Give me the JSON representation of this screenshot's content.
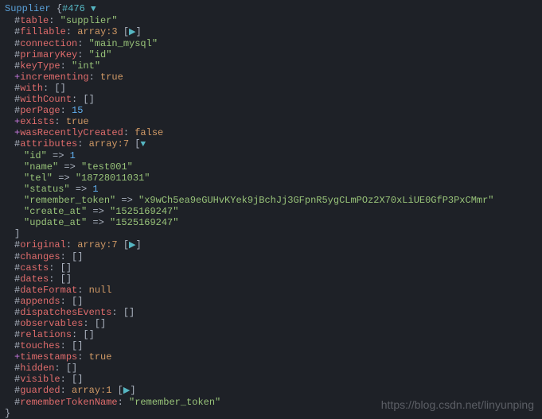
{
  "header": {
    "class_name": "Supplier",
    "hash_id": "#476",
    "arrow": "▼"
  },
  "props": [
    {
      "prefix": "#",
      "name": "table",
      "type": "str",
      "value": "\"supplier\""
    },
    {
      "prefix": "#",
      "name": "fillable",
      "type": "arr",
      "value": "array:3",
      "expand": "▶"
    },
    {
      "prefix": "#",
      "name": "connection",
      "type": "str",
      "value": "\"main_mysql\""
    },
    {
      "prefix": "#",
      "name": "primaryKey",
      "type": "str",
      "value": "\"id\""
    },
    {
      "prefix": "#",
      "name": "keyType",
      "type": "str",
      "value": "\"int\""
    },
    {
      "prefix": "+",
      "name": "incrementing",
      "type": "bool",
      "value": "true"
    },
    {
      "prefix": "#",
      "name": "with",
      "type": "empty",
      "value": "[]"
    },
    {
      "prefix": "#",
      "name": "withCount",
      "type": "empty",
      "value": "[]"
    },
    {
      "prefix": "#",
      "name": "perPage",
      "type": "num",
      "value": "15"
    },
    {
      "prefix": "+",
      "name": "exists",
      "type": "bool",
      "value": "true"
    },
    {
      "prefix": "+",
      "name": "wasRecentlyCreated",
      "type": "bool",
      "value": "false"
    },
    {
      "prefix": "#",
      "name": "attributes",
      "type": "arr",
      "value": "array:7",
      "expand": "▼"
    }
  ],
  "attributes": [
    {
      "key": "\"id\"",
      "type": "num",
      "value": "1"
    },
    {
      "key": "\"name\"",
      "type": "str",
      "value": "\"test001\""
    },
    {
      "key": "\"tel\"",
      "type": "str",
      "value": "\"18728011031\""
    },
    {
      "key": "\"status\"",
      "type": "num",
      "value": "1"
    },
    {
      "key": "\"remember_token\"",
      "type": "str",
      "value": "\"x9wCh5ea9eGUHvKYek9jBchJj3GFpnR5ygCLmPOz2X70xLiUE0GfP3PxCMmr\""
    },
    {
      "key": "\"create_at\"",
      "type": "str",
      "value": "\"1525169247\""
    },
    {
      "key": "\"update_at\"",
      "type": "str",
      "value": "\"1525169247\""
    }
  ],
  "close_attr": "]",
  "props2": [
    {
      "prefix": "#",
      "name": "original",
      "type": "arr",
      "value": "array:7",
      "expand": "▶"
    },
    {
      "prefix": "#",
      "name": "changes",
      "type": "empty",
      "value": "[]"
    },
    {
      "prefix": "#",
      "name": "casts",
      "type": "empty",
      "value": "[]"
    },
    {
      "prefix": "#",
      "name": "dates",
      "type": "empty",
      "value": "[]"
    },
    {
      "prefix": "#",
      "name": "dateFormat",
      "type": "null",
      "value": "null"
    },
    {
      "prefix": "#",
      "name": "appends",
      "type": "empty",
      "value": "[]"
    },
    {
      "prefix": "#",
      "name": "dispatchesEvents",
      "type": "empty",
      "value": "[]"
    },
    {
      "prefix": "#",
      "name": "observables",
      "type": "empty",
      "value": "[]"
    },
    {
      "prefix": "#",
      "name": "relations",
      "type": "empty",
      "value": "[]"
    },
    {
      "prefix": "#",
      "name": "touches",
      "type": "empty",
      "value": "[]"
    },
    {
      "prefix": "+",
      "name": "timestamps",
      "type": "bool",
      "value": "true"
    },
    {
      "prefix": "#",
      "name": "hidden",
      "type": "empty",
      "value": "[]"
    },
    {
      "prefix": "#",
      "name": "visible",
      "type": "empty",
      "value": "[]"
    },
    {
      "prefix": "#",
      "name": "guarded",
      "type": "arr",
      "value": "array:1",
      "expand": "▶"
    },
    {
      "prefix": "#",
      "name": "rememberTokenName",
      "type": "str",
      "value": "\"remember_token\""
    }
  ],
  "close_brace": "}",
  "watermark": "https://blog.csdn.net/linyunping"
}
